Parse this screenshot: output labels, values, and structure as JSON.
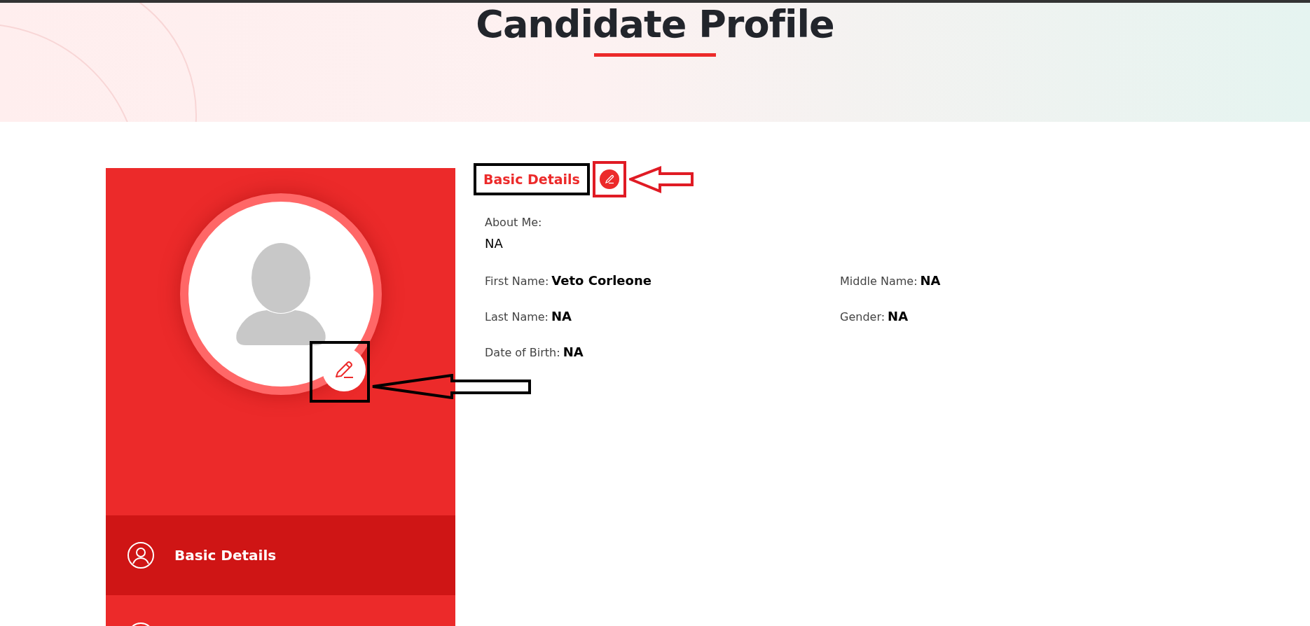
{
  "page_title": "Candidate Profile",
  "sidebar": {
    "items": [
      {
        "label": "Basic Details",
        "selected": true
      },
      {
        "selected": false
      }
    ]
  },
  "section": {
    "title": "Basic Details",
    "about": {
      "label": "About Me:",
      "value": "NA"
    },
    "fields": [
      {
        "label": "First Name:",
        "value": "Veto Corleone"
      },
      {
        "label": "Middle Name:",
        "value": "NA"
      },
      {
        "label": "Last Name:",
        "value": "NA"
      },
      {
        "label": "Gender:",
        "value": "NA"
      },
      {
        "label": "Date of Birth:",
        "value": "NA"
      }
    ]
  }
}
